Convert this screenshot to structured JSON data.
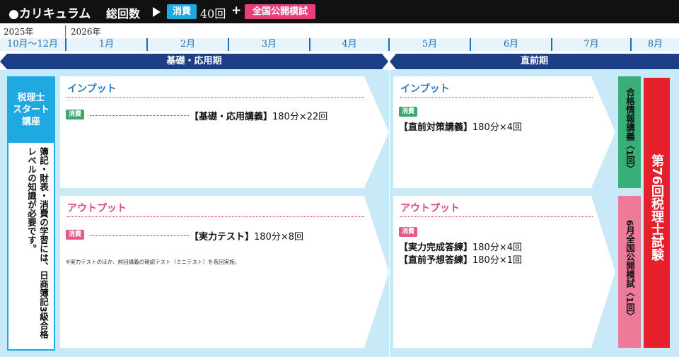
{
  "header": {
    "title": "●カリキュラム",
    "total_label": "総回数",
    "badge_consumption": "消費",
    "count": "40回",
    "plus": "+",
    "badge_mock": "全国公開模試"
  },
  "timeline": {
    "years": [
      "2025年",
      "2026年"
    ],
    "months": [
      "10月～12月",
      "1月",
      "2月",
      "3月",
      "4月",
      "5月",
      "6月",
      "7月",
      "8月"
    ],
    "periods": [
      "基礎・応用期",
      "直前期"
    ]
  },
  "starter": {
    "title_lines": [
      "税理士",
      "スタート",
      "講座"
    ],
    "note": "簿記・財表・消費の学習には、日商簿記3級合格レベルの知識が必要です。"
  },
  "basic_input": {
    "title": "インプット",
    "tag": "消費",
    "item_name": "【基礎・応用講義】",
    "item_detail": "180分×22回"
  },
  "basic_output": {
    "title": "アウトプット",
    "tag": "消費",
    "item_name": "【実力テスト】",
    "item_detail": "180分×8回",
    "note": "※実力テストのほか、前回講義の確認テスト（ミニテスト）を各回実施。"
  },
  "final_input": {
    "title": "インプット",
    "tag": "消費",
    "item_name": "【直前対策講義】",
    "item_detail": "180分×4回"
  },
  "final_output": {
    "title": "アウトプット",
    "tag": "消費",
    "items": [
      {
        "name": "【実力完成答練】",
        "detail": "180分×4回"
      },
      {
        "name": "【直前予想答練】",
        "detail": "180分×1回"
      }
    ]
  },
  "side": {
    "green_label": "合格情報講義〈1回〉",
    "pink_label": "6月全国公開模試〈1回〉",
    "exam_label": "第76回税理士試験"
  },
  "colors": {
    "header_bg": "#111111",
    "cyan": "#1ea9e0",
    "pink": "#e83f7c",
    "navy": "#1b3e86",
    "light_blue": "#c9e8f8",
    "green": "#3aae77",
    "red": "#e5202b"
  }
}
